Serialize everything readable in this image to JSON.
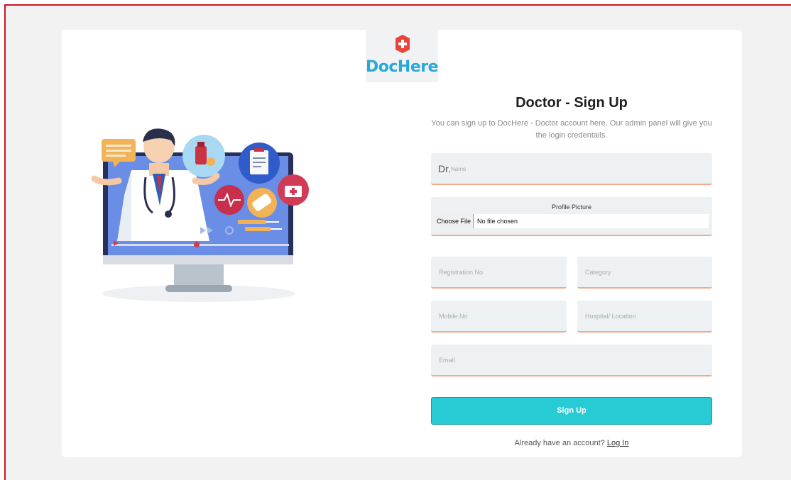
{
  "brand": {
    "name": "DocHere"
  },
  "form": {
    "title": "Doctor - Sign Up",
    "subtitle": "You can sign up to DocHere - Doctor account here. Our admin panel will give you the login credentails.",
    "name_prefix": "Dr.",
    "name_placeholder": "Name",
    "profile_picture_label": "Profile Picture",
    "choose_file_label": "Choose File",
    "no_file_text": "No file chosen",
    "registration_placeholder": "Registration No",
    "category_placeholder": "Category",
    "mobile_placeholder": "Mobile No",
    "hospital_placeholder": "Hospital/ Location",
    "email_placeholder": "Email",
    "submit_label": "Sign Up",
    "login_prompt": "Already have an account?",
    "login_link": "Log In"
  },
  "colors": {
    "accent": "#26cbd3",
    "brand_text": "#2aa8d8",
    "brand_mark": "#e8443a",
    "field_bg": "#edf1f4",
    "field_underline": "#f4a98b",
    "frame_border": "#d0141c"
  },
  "icons": [
    "medical-cross-logo-icon",
    "doctor-illustration"
  ]
}
